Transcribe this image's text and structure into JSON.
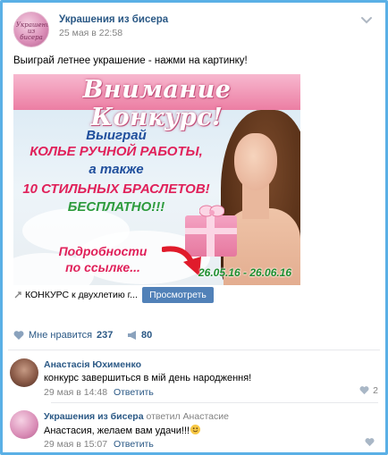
{
  "post": {
    "author": "Украшения из бисера",
    "avatar_text": "Украшения из бисера",
    "date": "25 мая в 22:58",
    "text": "Выиграй летнее украшение - нажми на картинку!"
  },
  "banner": {
    "title": "Внимание Конкурс!",
    "line1": "Выиграй",
    "line2": "КОЛЬЕ РУЧНОЙ РАБОТЫ,",
    "line3": "а также",
    "line4": "10 СТИЛЬНЫХ БРАСЛЕТОВ!",
    "line5": "БЕСПЛАТНО!!!",
    "details1": "Подробности",
    "details2": "по ссылке...",
    "dates": "26.05.16 - 26.06.16"
  },
  "link": {
    "text": "КОНКУРС к двухлетию г...",
    "button": "Просмотреть"
  },
  "reactions": {
    "likes_label": "Мне нравится",
    "likes_count": "237",
    "shares_count": "80"
  },
  "comments": [
    {
      "author": "Анастасія Юхименко",
      "answered": "",
      "text": "конкурс завершиться в мій день народження!",
      "date": "29 мая в 14:48",
      "reply": "Ответить",
      "likes": "2"
    },
    {
      "author": "Украшения из бисера",
      "answered": "ответил Анастасие",
      "text": "Анастасия, желаем вам удачи!!!",
      "date": "29 мая в 15:07",
      "reply": "Ответить",
      "likes": ""
    }
  ],
  "colors": {
    "frame": "#5ab0e6",
    "link": "#2a5885",
    "button": "#5181b8",
    "banner_pink": "#ec7ea3"
  }
}
